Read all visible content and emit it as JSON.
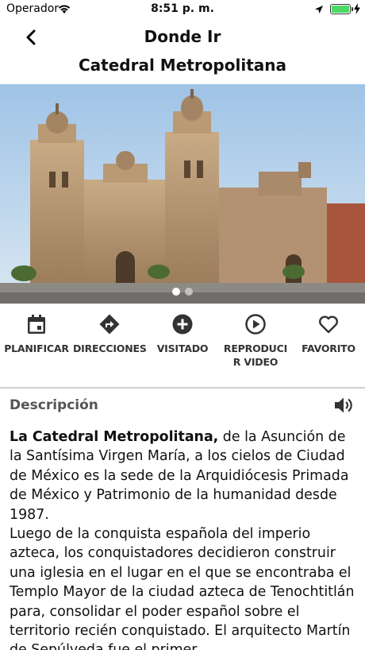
{
  "status_bar": {
    "carrier": "Operador",
    "time": "8:51 p. m."
  },
  "nav": {
    "title": "Donde Ir"
  },
  "place": {
    "title": "Catedral Metropolitana"
  },
  "carousel": {
    "current": 1,
    "total": 2
  },
  "actions": [
    {
      "label": "PLANIFICAR",
      "icon": "calendar-icon"
    },
    {
      "label": "DIRECCIONES",
      "icon": "directions-icon"
    },
    {
      "label": "VISITADO",
      "icon": "add-circle-icon"
    },
    {
      "label": "REPRODUCI\nR VIDEO",
      "icon": "play-circle-icon"
    },
    {
      "label": "FAVORITO",
      "icon": "heart-icon"
    }
  ],
  "description": {
    "heading": "Descripción",
    "lead": "La Catedral Metropolitana,",
    "text": " de la Asunción de la Santísima Virgen María, a los cielos de Ciudad de México es la sede de la Arquidiócesis Primada de México y Patrimonio de la humanidad desde 1987.",
    "paragraph2": "Luego de la conquista española del imperio azteca, los conquistadores decidieron construir una iglesia en el lugar en el que se encontraba el Templo Mayor de la ciudad azteca de Tenochtitlán para, consolidar el poder español sobre el territorio recién conquistado. El arquitecto Martín de Sepúlveda fue el primer"
  },
  "colors": {
    "sky": "#b9d3ea",
    "stone": "#b89a78",
    "accent": "#4cd964"
  }
}
